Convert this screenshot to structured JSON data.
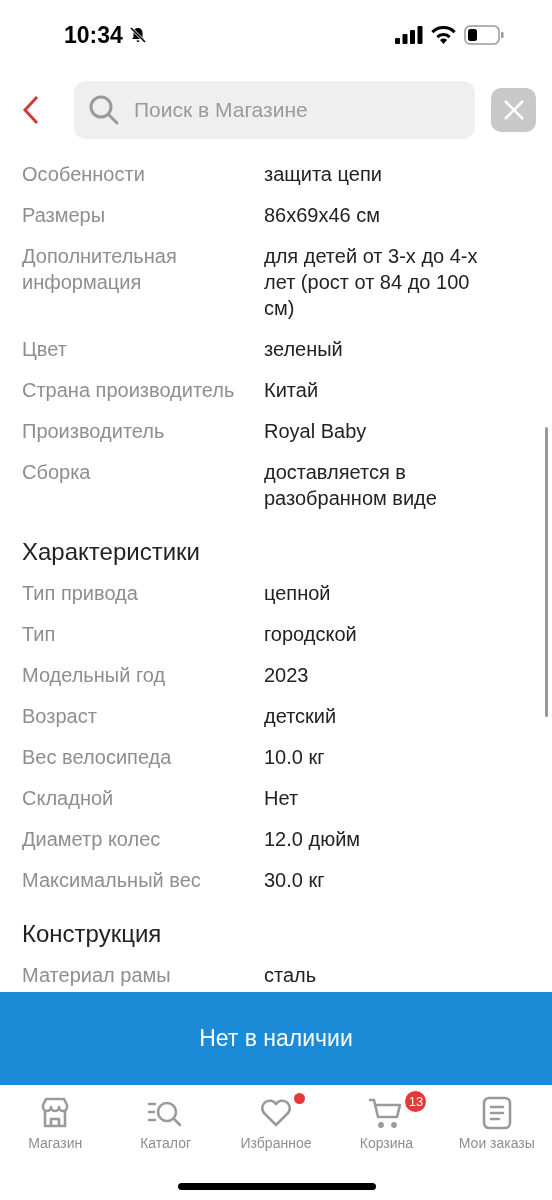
{
  "status_bar": {
    "time": "10:34"
  },
  "header": {
    "search": {
      "placeholder": "Поиск в Магазине"
    }
  },
  "sections": [
    {
      "rows": [
        {
          "label": "Особенности",
          "value": "защита цепи"
        },
        {
          "label": "Размеры",
          "value": "86x69x46 см"
        },
        {
          "label": "Дополнительная информация",
          "value": "для детей от 3-х до 4-х лет (рост от 84 до 100 см)"
        },
        {
          "label": "Цвет",
          "value": "зеленый"
        },
        {
          "label": "Страна производитель",
          "value": "Китай"
        },
        {
          "label": "Производитель",
          "value": "Royal Baby"
        },
        {
          "label": "Сборка",
          "value": "доставляется в разобранном виде"
        }
      ]
    },
    {
      "title": "Характеристики",
      "rows": [
        {
          "label": "Тип привода",
          "value": "цепной"
        },
        {
          "label": "Тип",
          "value": "городской"
        },
        {
          "label": "Модельный год",
          "value": "2023"
        },
        {
          "label": "Возраст",
          "value": "детский"
        },
        {
          "label": "Вес велосипеда",
          "value": "10.0 кг"
        },
        {
          "label": "Складной",
          "value": "Нет"
        },
        {
          "label": "Диаметр колес",
          "value": "12.0 дюйм"
        },
        {
          "label": "Максимальный вес",
          "value": "30.0 кг"
        }
      ]
    },
    {
      "title": "Конструкция",
      "rows": [
        {
          "label": "Материал рамы",
          "value": "сталь"
        }
      ]
    }
  ],
  "action_button": {
    "label": "Нет в наличии"
  },
  "bottom_nav": [
    {
      "kind": "store",
      "label": "Магазин",
      "dot": false
    },
    {
      "kind": "catalog",
      "label": "Каталог",
      "dot": false
    },
    {
      "kind": "favorites",
      "label": "Избранное",
      "dot": true
    },
    {
      "kind": "cart",
      "label": "Корзина",
      "badge": "13",
      "dot": false
    },
    {
      "kind": "orders",
      "label": "Мои заказы",
      "dot": false
    }
  ]
}
